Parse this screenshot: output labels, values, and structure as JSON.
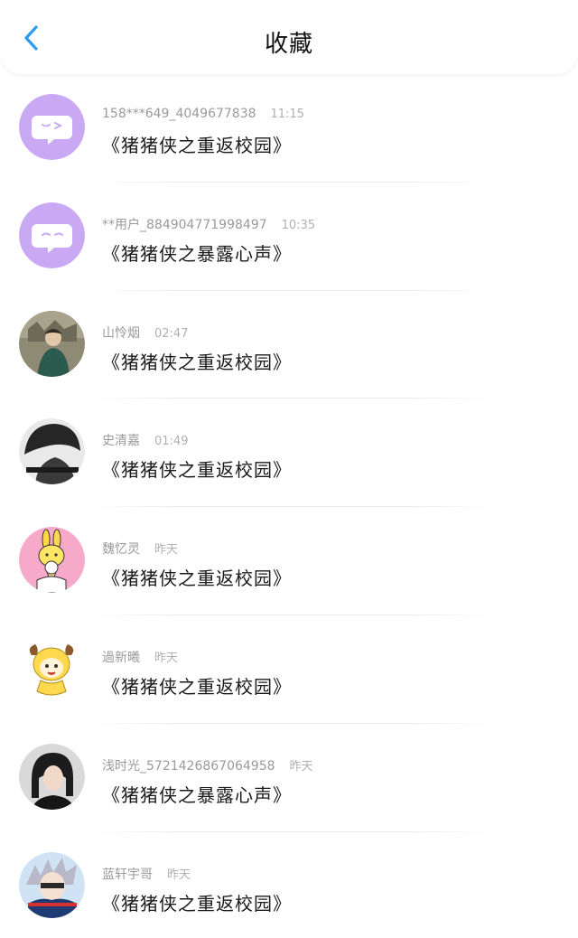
{
  "header": {
    "title": "收藏",
    "back_icon": "chevron-left-icon",
    "accent_color": "#2b9cf2"
  },
  "favorites": [
    {
      "user": "158***649_4049677838",
      "time": "11:15",
      "work": "《猪猪侠之重返校园》",
      "avatar": "purple-chat-avatar"
    },
    {
      "user": "**用户_884904771998497",
      "time": "10:35",
      "work": "《猪猪侠之暴露心声》",
      "avatar": "purple-chat-avatar"
    },
    {
      "user": "山怜烟",
      "time": "02:47",
      "work": "《猪猪侠之重返校园》",
      "avatar": "photo-avatar"
    },
    {
      "user": "史清嘉",
      "time": "01:49",
      "work": "《猪猪侠之重返校园》",
      "avatar": "grayscale-photo-avatar"
    },
    {
      "user": "魏忆灵",
      "time": "昨天",
      "work": "《猪猪侠之重返校园》",
      "avatar": "cartoon-bunny-avatar"
    },
    {
      "user": "過新曦",
      "time": "昨天",
      "work": "《猪猪侠之重返校园》",
      "avatar": "cartoon-yellow-avatar"
    },
    {
      "user": "浅时光_5721426867064958",
      "time": "昨天",
      "work": "《猪猪侠之暴露心声》",
      "avatar": "photo-avatar"
    },
    {
      "user": "蓝轩宇哥",
      "time": "昨天",
      "work": "《猪猪侠之重返校园》",
      "avatar": "anime-avatar"
    }
  ]
}
